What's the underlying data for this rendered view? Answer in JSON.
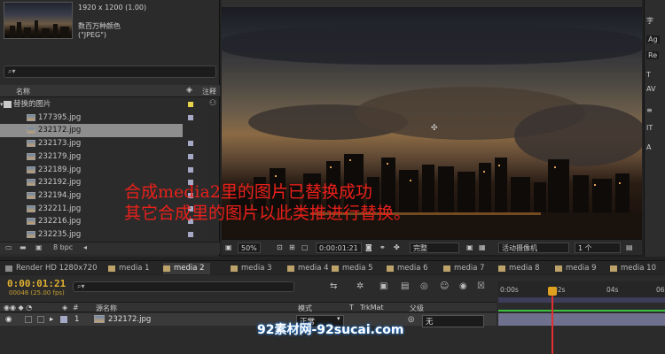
{
  "project": {
    "info_size": "1920 x 1200 (1.00)",
    "info_colors": "数百万种颜色",
    "info_format": "(\"JPEG\")",
    "search_placeholder": "",
    "col_name": "名称",
    "col_comment": "注释",
    "folder": "替换的图片",
    "files": [
      "177395.jpg",
      "232172.jpg",
      "232173.jpg",
      "232179.jpg",
      "232189.jpg",
      "232192.jpg",
      "232194.jpg",
      "232211.jpg",
      "232216.jpg",
      "232235.jpg"
    ],
    "selected_file": "232172.jpg",
    "bpc": "8 bpc"
  },
  "viewer": {
    "zoom": "50%",
    "timecode": "0:00:01:21",
    "resolution": "完整",
    "camera": "活动摄像机",
    "views": "1 个"
  },
  "tabs": [
    "Render HD 1280x720",
    "media 1",
    "media 2",
    "media 3",
    "media 4",
    "media 5",
    "media 6",
    "media 7",
    "media 8",
    "media 9",
    "media 10"
  ],
  "active_tab": "media 2",
  "timeline": {
    "timecode": "0:00:01:21",
    "frames": "00046 (25.00 fps)",
    "ruler_ticks": [
      "0:00s",
      "02s",
      "04s",
      "06s"
    ],
    "columns": {
      "source": "源名称",
      "mode": "模式",
      "t": "T",
      "trkmat": "TrkMat",
      "parent": "父级"
    },
    "layer": {
      "index": "1",
      "name": "232172.jpg",
      "mode": "正常",
      "parent": "无"
    }
  },
  "caption": {
    "line1": "合成media2里的图片已替换成功",
    "line2": "其它合成里的图片以此类推进行替换。"
  },
  "watermark": "92素材网-92sucai.com",
  "right_panel": {
    "label1": "字",
    "label2": "Ag",
    "label3": "Re"
  },
  "colors": {
    "accent_timecode": "#e0b030",
    "caption": "#e8201a",
    "playhead": "#e03030",
    "layer_bar": "#8c8fb8"
  }
}
